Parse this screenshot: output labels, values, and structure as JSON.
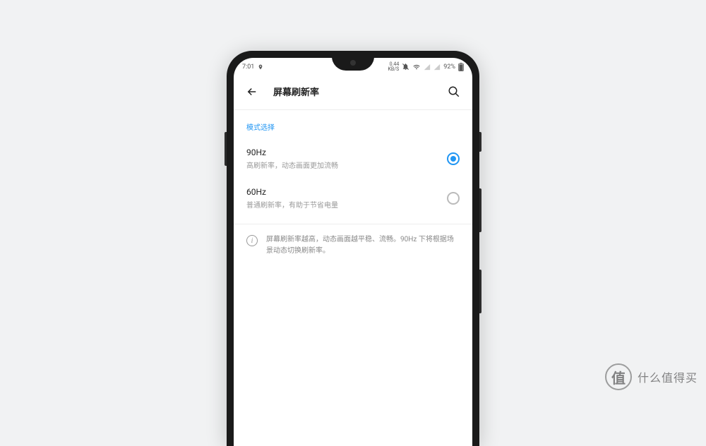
{
  "status_bar": {
    "time": "7:01",
    "data_rate": "0.44",
    "data_unit": "KB/S",
    "battery_pct": "92%"
  },
  "header": {
    "title": "屏幕刷新率"
  },
  "section_label": "模式选择",
  "options": [
    {
      "title": "90Hz",
      "subtitle": "高刷新率，动态画面更加流畅",
      "selected": true
    },
    {
      "title": "60Hz",
      "subtitle": "普通刷新率，有助于节省电量",
      "selected": false
    }
  ],
  "info_text": "屏幕刷新率越高，动态画面越平稳、流畅。90Hz 下将根据场景动态切换刷新率。",
  "watermark": {
    "badge": "值",
    "text": "什么值得买"
  }
}
